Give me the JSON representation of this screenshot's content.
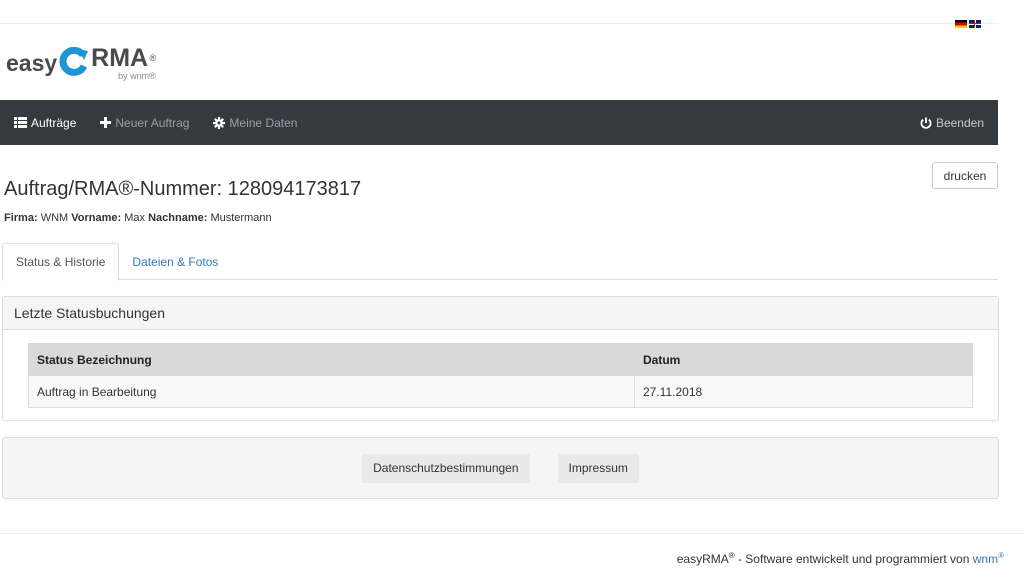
{
  "languages": [
    {
      "code": "de",
      "icon": "flag-de-icon"
    },
    {
      "code": "en",
      "icon": "flag-uk-icon"
    }
  ],
  "logo": {
    "easy": "easy",
    "rma": "RMA",
    "reg": "®",
    "by": "by wnm®",
    "accent_color": "#1e96d4"
  },
  "nav": {
    "items": [
      {
        "label": "Aufträge",
        "icon": "list-icon",
        "active": true
      },
      {
        "label": "Neuer Auftrag",
        "icon": "plus-icon",
        "active": false
      },
      {
        "label": "Meine Daten",
        "icon": "gear-icon",
        "active": false
      }
    ],
    "logout": {
      "label": "Beenden",
      "icon": "power-icon"
    },
    "bg_color": "#343a40"
  },
  "actions": {
    "print_label": "drucken"
  },
  "order": {
    "title": "Auftrag/RMA®-Nummer: 128094173817",
    "company_label": "Firma:",
    "company": "WNM",
    "firstname_label": "Vorname:",
    "firstname": "Max",
    "lastname_label": "Nachname:",
    "lastname": "Mustermann"
  },
  "tabs": [
    {
      "label": "Status & Historie",
      "active": true
    },
    {
      "label": "Dateien & Fotos",
      "active": false
    }
  ],
  "status_panel": {
    "heading": "Letzte Statusbuchungen",
    "columns": [
      "Status Bezeichnung",
      "Datum"
    ],
    "rows": [
      {
        "status": "Auftrag in Bearbeitung",
        "date": "27.11.2018"
      }
    ]
  },
  "footer": {
    "privacy_label": "Datenschutzbestimmungen",
    "imprint_label": "Impressum",
    "credit_prefix": "easyRMA",
    "credit_reg": "®",
    "credit_text": " - Software entwickelt und programmiert von ",
    "credit_link": "wnm",
    "credit_link_reg": "®"
  }
}
